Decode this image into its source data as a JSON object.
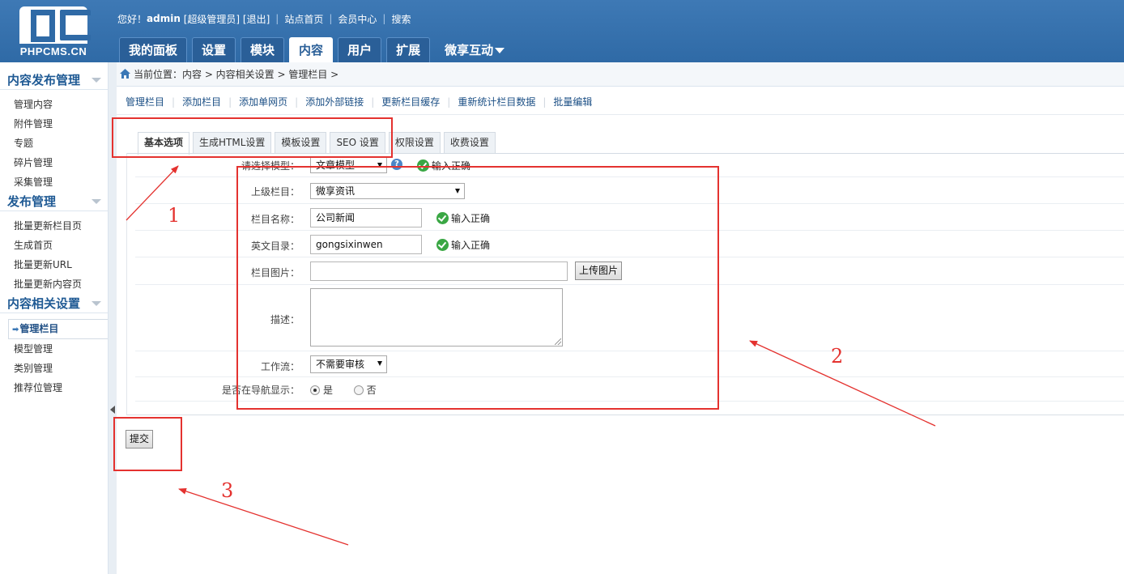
{
  "logo": {
    "mark": "PC",
    "text": "PHPCMS.CN"
  },
  "topbar": {
    "greeting": "您好！",
    "username": "admin",
    "role": "[超级管理员]",
    "logout": "[退出]",
    "site_home": "站点首页",
    "member_center": "会员中心",
    "search": "搜索"
  },
  "nav": {
    "tabs": [
      "我的面板",
      "设置",
      "模块",
      "内容",
      "用户",
      "扩展"
    ],
    "active": "内容",
    "extra": "微享互动"
  },
  "sidebar": {
    "groups": [
      {
        "title": "内容发布管理",
        "items": [
          "管理内容",
          "附件管理",
          "专题",
          "碎片管理",
          "采集管理"
        ]
      },
      {
        "title": "发布管理",
        "items": [
          "批量更新栏目页",
          "生成首页",
          "批量更新URL",
          "批量更新内容页"
        ]
      },
      {
        "title": "内容相关设置",
        "items": [
          "管理栏目",
          "模型管理",
          "类别管理",
          "推荐位管理"
        ]
      }
    ],
    "active_item": "管理栏目"
  },
  "breadcrumb": {
    "text": "当前位置：内容 > 内容相关设置 > 管理栏目 >"
  },
  "subnav": [
    "管理栏目",
    "添加栏目",
    "添加单网页",
    "添加外部链接",
    "更新栏目缓存",
    "重新统计栏目数据",
    "批量编辑"
  ],
  "tabs": [
    "基本选项",
    "生成HTML设置",
    "模板设置",
    "SEO 设置",
    "权限设置",
    "收费设置"
  ],
  "active_tab": "基本选项",
  "form": {
    "model_label": "请选择模型：",
    "model_value": "文章模型",
    "help_icon_text": "?",
    "ok_text": "输入正确",
    "parent_label": "上级栏目：",
    "parent_value": "微享资讯",
    "name_label": "栏目名称：",
    "name_value": "公司新闻",
    "dir_label": "英文目录：",
    "dir_value": "gongsixinwen",
    "image_label": "栏目图片：",
    "image_value": "",
    "upload_button": "上传图片",
    "desc_label": "描述：",
    "desc_value": "",
    "workflow_label": "工作流：",
    "workflow_value": "不需要审核",
    "nav_show_label": "是否在导航显示：",
    "nav_show_yes": "是",
    "nav_show_no": "否",
    "nav_show_selected": "是"
  },
  "submit_button": "提交",
  "annotations": {
    "color": "#e4322f",
    "labels": [
      "1",
      "2",
      "3"
    ]
  },
  "colors": {
    "header": "#3e79b5",
    "link": "#1b4f85",
    "ok_green": "#3aa744"
  }
}
